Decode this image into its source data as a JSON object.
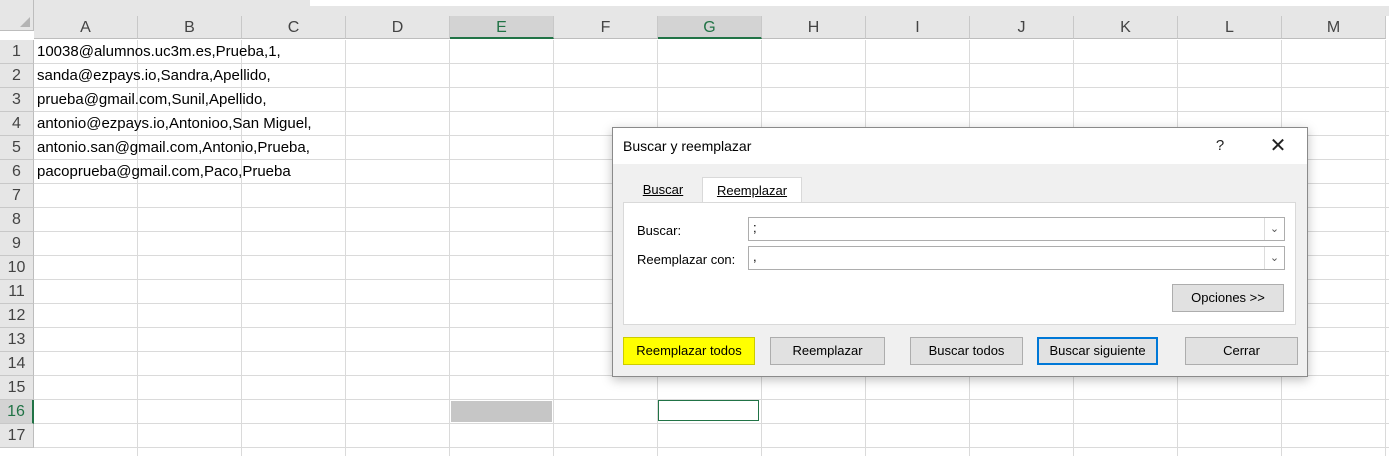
{
  "columns": [
    "A",
    "B",
    "C",
    "D",
    "E",
    "F",
    "G",
    "H",
    "I",
    "J",
    "K",
    "L",
    "M"
  ],
  "rows": [
    "1",
    "2",
    "3",
    "4",
    "5",
    "6",
    "7",
    "8",
    "9",
    "10",
    "11",
    "12",
    "13",
    "14",
    "15",
    "16",
    "17"
  ],
  "cells_A": [
    "10038@alumnos.uc3m.es,Prueba,1,",
    "sanda@ezpays.io,Sandra,Apellido,",
    "prueba@gmail.com,Sunil,Apellido,",
    "antonio@ezpays.io,Antonioo,San Miguel,",
    "antonio.san@gmail.com,Antonio,Prueba,",
    "pacoprueba@gmail.com,Paco,Prueba"
  ],
  "dialog": {
    "title": "Buscar y reemplazar",
    "help": "?",
    "close": "✕",
    "tabs": {
      "buscar": "Buscar",
      "reemplazar": "Reemplazar"
    },
    "find_label": "Buscar:",
    "find_value": ";",
    "replace_label": "Reemplazar con:",
    "replace_value": ",",
    "options_button": "Opciones >>",
    "buttons": {
      "replace_all": "Reemplazar todos",
      "replace": "Reemplazar",
      "find_all": "Buscar todos",
      "find_next": "Buscar siguiente",
      "close": "Cerrar"
    }
  },
  "colors": {
    "accent": "#217346",
    "focus": "#0078d7",
    "highlight": "#ffff00"
  }
}
